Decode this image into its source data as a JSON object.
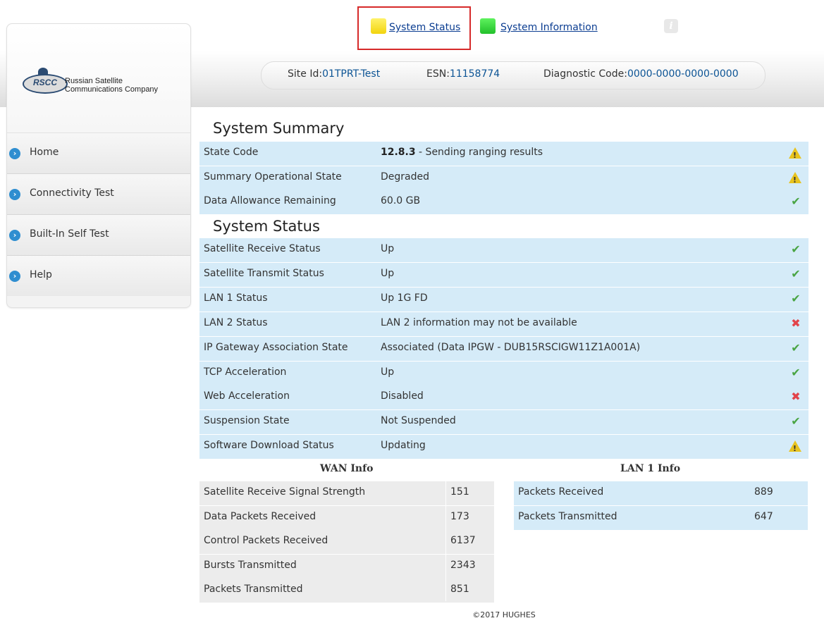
{
  "logo": {
    "mark": "RSCC",
    "line1": "Russian Satellite",
    "line2": "Communications Company"
  },
  "tabs": [
    {
      "label": "System Status",
      "icon": "yellow-square",
      "color": "#f2d40e"
    },
    {
      "label": "System Information",
      "icon": "green-square",
      "color": "#22c02a"
    }
  ],
  "header": {
    "site_id_label": "Site Id:",
    "site_id": "01TPRT-Test",
    "esn_label": "ESN:",
    "esn": "11158774",
    "diag_label": "Diagnostic Code:",
    "diag_code": "0000-0000-0000-0000"
  },
  "sidebar": {
    "items": [
      {
        "label": "Home"
      },
      {
        "label": "Connectivity Test"
      },
      {
        "label": "Built-In Self Test"
      },
      {
        "label": "Help"
      }
    ]
  },
  "summary": {
    "title": "System Summary",
    "rows": [
      {
        "label": "State Code",
        "value_bold": "12.8.3",
        "value": " - Sending ranging results",
        "status": "warning"
      },
      {
        "label": "Summary Operational State",
        "value_bold": "",
        "value": "Degraded",
        "status": "warning"
      },
      {
        "label": "Data Allowance Remaining",
        "value_bold": "",
        "value": "60.0 GB",
        "status": "ok"
      }
    ]
  },
  "status": {
    "title": "System Status",
    "rows": [
      {
        "label": "Satellite Receive Status",
        "value": "Up",
        "status": "ok"
      },
      {
        "label": "Satellite Transmit Status",
        "value": "Up",
        "status": "ok"
      },
      {
        "label": "LAN 1 Status",
        "value": "Up 1G FD",
        "status": "ok"
      },
      {
        "label": "LAN 2 Status",
        "value": "LAN 2 information may not be available",
        "status": "error"
      },
      {
        "label": "IP Gateway Association State",
        "value": "Associated (Data IPGW - DUB15RSCIGW11Z1A001A)",
        "status": "ok"
      },
      {
        "label": "TCP Acceleration",
        "value": "Up",
        "status": "ok"
      },
      {
        "label": "Web Acceleration",
        "value": "Disabled",
        "status": "error"
      },
      {
        "label": "Suspension State",
        "value": "Not Suspended",
        "status": "ok"
      },
      {
        "label": "Software Download Status",
        "value": "Updating",
        "status": "warning"
      }
    ]
  },
  "wan": {
    "title": "WAN Info",
    "rows": [
      {
        "label": "Satellite Receive Signal Strength",
        "value": "151"
      },
      {
        "label": "Data Packets Received",
        "value": "173"
      },
      {
        "label": "Control Packets Received",
        "value": "6137"
      },
      {
        "label": "Bursts Transmitted",
        "value": "2343"
      },
      {
        "label": "Packets Transmitted",
        "value": "851"
      }
    ]
  },
  "lan": {
    "title": "LAN 1 Info",
    "rows": [
      {
        "label": "Packets Received",
        "value": "889"
      },
      {
        "label": "Packets Transmitted",
        "value": "647"
      }
    ]
  },
  "footer": "©2017 HUGHES"
}
